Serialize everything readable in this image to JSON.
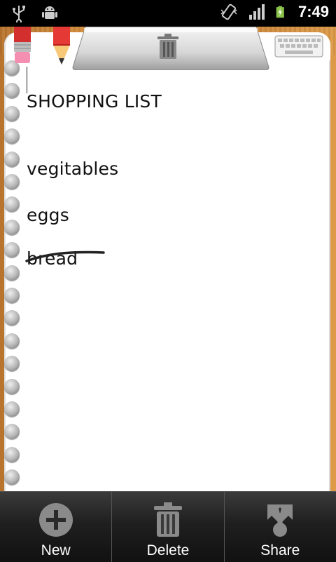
{
  "status_bar": {
    "time": "7:49",
    "icons": [
      "usb-icon",
      "android-debug-icon",
      "vibrate-icon",
      "signal-icon",
      "battery-charging-icon"
    ]
  },
  "toolbar": {
    "icons": [
      "eraser-icon",
      "pencil-icon",
      "trash-icon",
      "keyboard-icon"
    ]
  },
  "note": {
    "lines": [
      {
        "text": "SHOPPING LIST",
        "checked": false
      },
      {
        "text": "vegitables",
        "checked": false
      },
      {
        "text": "eggs",
        "checked": false
      },
      {
        "text": "bread",
        "checked": true
      }
    ]
  },
  "menu": {
    "items": [
      {
        "label": "New",
        "icon": "add-icon"
      },
      {
        "label": "Delete",
        "icon": "trash-icon"
      },
      {
        "label": "Share",
        "icon": "share-icon"
      }
    ]
  },
  "colors": {
    "board": "#d08a3c",
    "paper": "#ffffff",
    "ink": "#111111",
    "menu_bg": "#1f1f1f",
    "battery": "#8bc34a"
  }
}
